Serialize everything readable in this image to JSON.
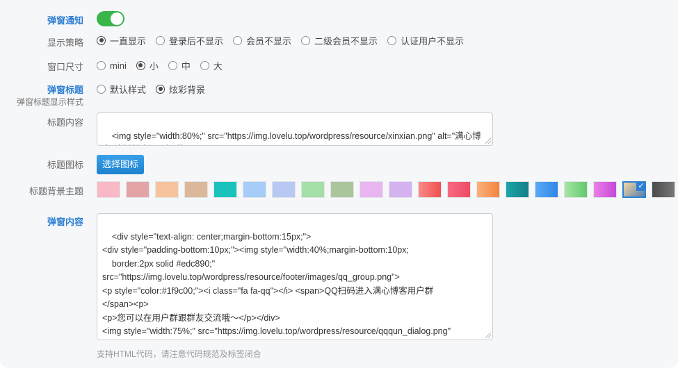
{
  "fields": {
    "popup_notice": {
      "label": "弹窗通知",
      "enabled": true
    },
    "display_strategy": {
      "label": "显示策略",
      "options": [
        "一直显示",
        "登录后不显示",
        "会员不显示",
        "二级会员不显示",
        "认证用户不显示"
      ],
      "selected": "一直显示"
    },
    "window_size": {
      "label": "窗口尺寸",
      "options": [
        "mini",
        "小",
        "中",
        "大"
      ],
      "selected": "小"
    },
    "popup_title": {
      "label": "弹窗标题",
      "sublabel": "弹窗标题显示样式",
      "options": [
        "默认样式",
        "炫彩背景"
      ],
      "selected": "炫彩背景"
    },
    "title_content": {
      "label": "标题内容",
      "value": "<img style=\"width:80%;\" src=\"https://img.lovelu.top/wordpress/resource/xinxian.png\" alt=\"满心博客-让新鲜资源早知道\">"
    },
    "title_icon": {
      "label": "标题图标",
      "button": "选择图标"
    },
    "title_bg_theme": {
      "label": "标题背景主题",
      "swatches": [
        "#f8b8c6",
        "#e3a4a8",
        "#f7c39c",
        "#dcb89a",
        "#19c2bb",
        "#a6cdf7",
        "#b7c8f2",
        "#a3dfa6",
        "#abc59c",
        "#e9b5f1",
        "#d5b3f0",
        "linear-gradient(90deg,#f88a8a,#f25050)",
        "linear-gradient(90deg,#f66a82,#f04a63)",
        "linear-gradient(90deg,#fbb27a,#f3843e)",
        "linear-gradient(90deg,#1aa6a8,#137f86)",
        "linear-gradient(90deg,#5aa9f5,#2f86e8)",
        "linear-gradient(90deg,#a8e6a4,#62c86c)",
        "linear-gradient(90deg,#eb7fe8,#c648d8)",
        "linear-gradient(135deg,#f3d7a4,#5b7fa8)",
        "linear-gradient(90deg,#4a4a4a,#777777)"
      ],
      "selected_index": 18
    },
    "popup_content": {
      "label": "弹窗内容",
      "value": "<div style=\"text-align: center;margin-bottom:15px;\">\n<div style=\"padding-bottom:10px;\"><img style=\"width:40%;margin-bottom:10px;\n    border:2px solid #edc890;\"\nsrc=\"https://img.lovelu.top/wordpress/resource/footer/images/qq_group.png\">\n<p style=\"color:#1f9c00;\"><i class=\"fa fa-qq\"></i> <span>QQ扫码进入满心博客用户群\n</span><p>\n<p>您可以在用户群跟群友交流哦～</p></div>\n<img style=\"width:75%;\" src=\"https://img.lovelu.top/wordpress/resource/qqqun_dialog.png\"\nalt=\"快来加入吧～\"></div>",
      "hint": "支持HTML代码，请注意代码规范及标签闭合"
    }
  },
  "colors": {
    "accent": "#2e7fd4",
    "switch_on": "#39b54a"
  }
}
